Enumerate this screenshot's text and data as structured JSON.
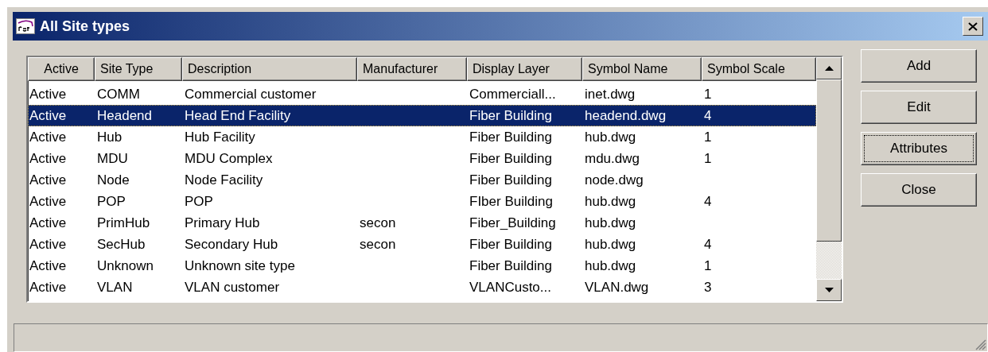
{
  "window": {
    "title": "All Site types"
  },
  "table": {
    "columns": [
      "Active",
      "Site Type",
      "Description",
      "Manufacturer",
      "Display Layer",
      "Symbol Name",
      "Symbol Scale"
    ],
    "rows": [
      {
        "cells": [
          "Active",
          "COMM",
          "Commercial customer",
          "",
          "Commerciall...",
          "inet.dwg",
          "1"
        ],
        "selected": false
      },
      {
        "cells": [
          "Active",
          "Headend",
          "Head End Facility",
          "",
          "Fiber Building",
          "headend.dwg",
          "4"
        ],
        "selected": true
      },
      {
        "cells": [
          "Active",
          "Hub",
          "Hub Facility",
          "",
          "Fiber Building",
          "hub.dwg",
          "1"
        ],
        "selected": false
      },
      {
        "cells": [
          "Active",
          "MDU",
          "MDU Complex",
          "",
          "Fiber Building",
          "mdu.dwg",
          "1"
        ],
        "selected": false
      },
      {
        "cells": [
          "Active",
          "Node",
          "Node Facility",
          "",
          "Fiber Building",
          "node.dwg",
          ""
        ],
        "selected": false
      },
      {
        "cells": [
          "Active",
          "POP",
          "POP",
          "",
          "FIber Building",
          "hub.dwg",
          "4"
        ],
        "selected": false
      },
      {
        "cells": [
          "Active",
          "PrimHub",
          "Primary Hub",
          "secon",
          "Fiber_Building",
          "hub.dwg",
          ""
        ],
        "selected": false
      },
      {
        "cells": [
          "Active",
          "SecHub",
          "Secondary Hub",
          "secon",
          "Fiber Building",
          "hub.dwg",
          "4"
        ],
        "selected": false
      },
      {
        "cells": [
          "Active",
          "Unknown",
          "Unknown site type",
          "",
          "Fiber Building",
          "hub.dwg",
          "1"
        ],
        "selected": false
      },
      {
        "cells": [
          "Active",
          "VLAN",
          "VLAN customer",
          "",
          "VLANCusto...",
          "VLAN.dwg",
          "3"
        ],
        "selected": false
      }
    ]
  },
  "buttons": [
    {
      "label": "Add",
      "focused": false
    },
    {
      "label": "Edit",
      "focused": false
    },
    {
      "label": "Attributes",
      "focused": true
    },
    {
      "label": "Close",
      "focused": false
    }
  ]
}
